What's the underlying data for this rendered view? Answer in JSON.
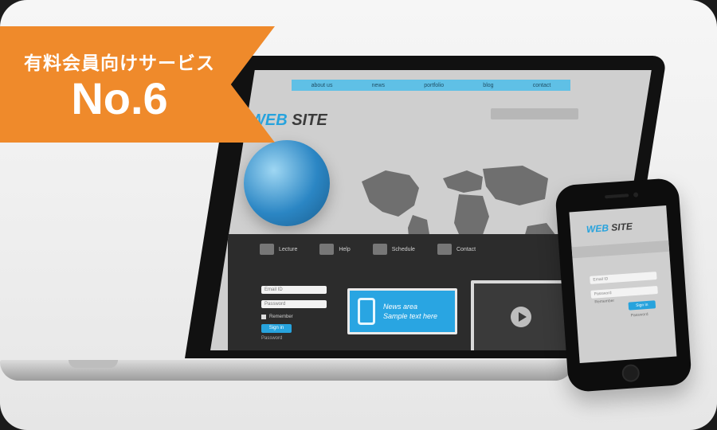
{
  "ribbon": {
    "title": "有料会員向けサービス",
    "rank": "No.6"
  },
  "site": {
    "brand_prefix": "WEB",
    "brand_suffix": "SITE",
    "nav": [
      "about us",
      "news",
      "portfolio",
      "blog",
      "contact"
    ],
    "icons": [
      {
        "name": "lecture-icon",
        "label": "Lecture"
      },
      {
        "name": "help-icon",
        "label": "Help"
      },
      {
        "name": "schedule-icon",
        "label": "Schedule"
      },
      {
        "name": "contact-icon",
        "label": "Contact"
      }
    ],
    "login": {
      "email_placeholder": "Email ID",
      "password_placeholder": "Password",
      "remember_label": "Remember",
      "signin_label": "Sign in",
      "forgot_label": "Password"
    },
    "news": {
      "line1": "News area",
      "line2": "Sample text here"
    },
    "video": {
      "cta": "view"
    }
  },
  "phone": {
    "brand_prefix": "WEB",
    "brand_suffix": "SITE",
    "login": {
      "email_placeholder": "Email ID",
      "password_placeholder": "Password",
      "remember_label": "Remember",
      "signin_label": "Sign in",
      "forgot_label": "Password"
    }
  },
  "colors": {
    "ribbon": "#ef8a2b",
    "accent": "#27a3dd"
  }
}
